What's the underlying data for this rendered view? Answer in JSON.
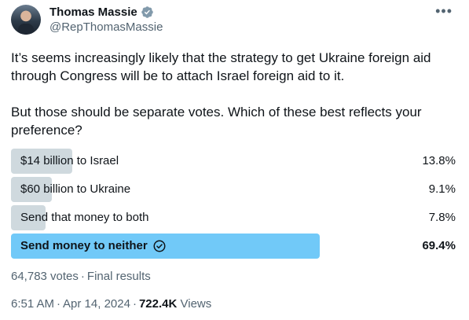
{
  "author": {
    "name": "Thomas Massie",
    "handle": "@RepThomasMassie"
  },
  "tweet_text": "It’s seems increasingly likely that the strategy to get Ukraine foreign aid through Congress will be to attach Israel foreign aid to it.\n\nBut those should be separate votes. Which of these best reflects your preference?",
  "poll": {
    "options": [
      {
        "label": "$14 billion to Israel",
        "percent": "13.8%",
        "fraction": 0.138,
        "winner": false
      },
      {
        "label": "$60 billion to Ukraine",
        "percent": "9.1%",
        "fraction": 0.091,
        "winner": false
      },
      {
        "label": "Send that money to both",
        "percent": "7.8%",
        "fraction": 0.078,
        "winner": false
      },
      {
        "label": "Send money to neither",
        "percent": "69.4%",
        "fraction": 0.694,
        "winner": true
      }
    ],
    "votes": "64,783 votes",
    "status": "Final results"
  },
  "footer": {
    "time": "6:51 AM",
    "date": "Apr 14, 2024",
    "views_count": "722.4K",
    "views_label": "Views"
  },
  "colors": {
    "bar": "#cfd9de",
    "winner_bar": "#71c9f8",
    "verified": "#829aab",
    "secondary_text": "#536471"
  },
  "icons": {
    "verified": "verified-badge-icon",
    "more": "more-options-icon",
    "winner": "check-circle-icon"
  }
}
